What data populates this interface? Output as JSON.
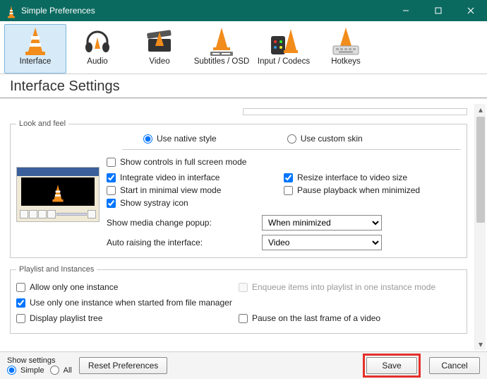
{
  "window": {
    "title": "Simple Preferences"
  },
  "tabs": [
    {
      "label": "Interface"
    },
    {
      "label": "Audio"
    },
    {
      "label": "Video"
    },
    {
      "label": "Subtitles / OSD"
    },
    {
      "label": "Input / Codecs"
    },
    {
      "label": "Hotkeys"
    }
  ],
  "heading": "Interface Settings",
  "groups": {
    "lookfeel": {
      "legend": "Look and feel",
      "style_native": "Use native style",
      "style_skin": "Use custom skin",
      "show_controls_fullscreen": "Show controls in full screen mode",
      "integrate_video": "Integrate video in interface",
      "resize_to_video": "Resize interface to video size",
      "start_minimal": "Start in minimal view mode",
      "pause_minimized": "Pause playback when minimized",
      "systray": "Show systray icon",
      "media_change_label": "Show media change popup:",
      "media_change_value": "When minimized",
      "auto_raise_label": "Auto raising the interface:",
      "auto_raise_value": "Video"
    },
    "playlist": {
      "legend": "Playlist and Instances",
      "one_instance": "Allow only one instance",
      "enqueue": "Enqueue items into playlist in one instance mode",
      "one_instance_fm": "Use only one instance when started from file manager",
      "display_tree": "Display playlist tree",
      "pause_last_frame": "Pause on the last frame of a video"
    }
  },
  "show_settings": {
    "label": "Show settings",
    "simple": "Simple",
    "all": "All"
  },
  "buttons": {
    "reset": "Reset Preferences",
    "save": "Save",
    "cancel": "Cancel"
  },
  "icons": {
    "cone": "traffic-cone",
    "headphones": "headphones",
    "clapper": "clapperboard-cone",
    "subtitles": "subtitles-cone",
    "codecs": "remote-cone",
    "hotkeys": "keyboard-cone"
  },
  "colors": {
    "titlebar": "#0b6a60",
    "tab_selected_bg": "#d6eaf8",
    "highlight_border": "#e5302b"
  }
}
